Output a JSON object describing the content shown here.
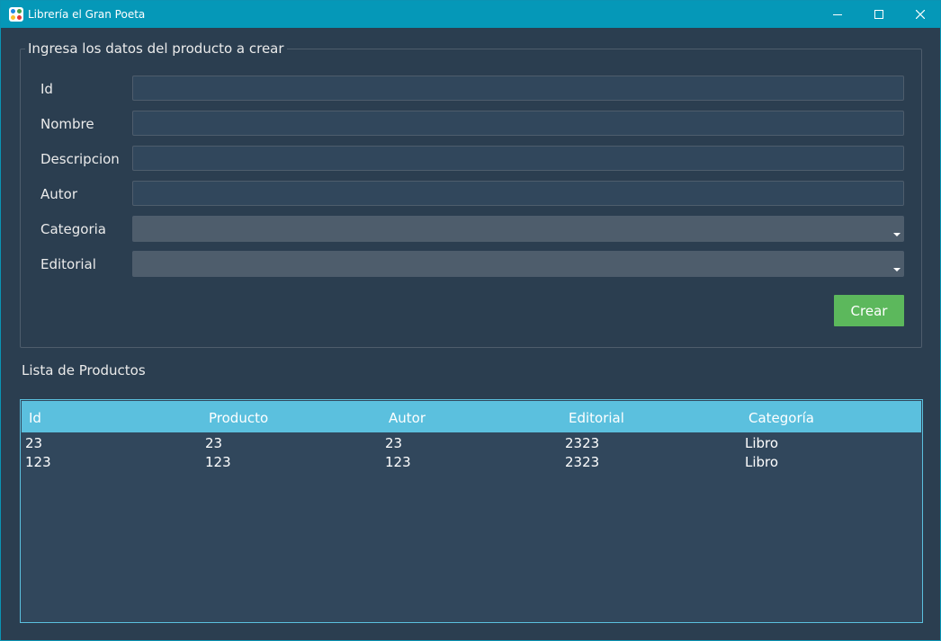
{
  "window": {
    "title": "Librería el Gran Poeta",
    "accent_color": "#0598b8",
    "icons": [
      "app-icon",
      "minimize-icon",
      "maximize-icon",
      "close-icon"
    ]
  },
  "form": {
    "group_title": "Ingresa los datos del producto a crear",
    "id_label": "Id",
    "id_value": "",
    "nombre_label": "Nombre",
    "nombre_value": "",
    "descripcion_label": "Descripcion",
    "descripcion_value": "",
    "autor_label": "Autor",
    "autor_value": "",
    "categoria_label": "Categoria",
    "categoria_value": "",
    "editorial_label": "Editorial",
    "editorial_value": "",
    "create_button": "Crear",
    "create_button_color": "#5cb85c"
  },
  "products": {
    "section_title": "Lista de Productos",
    "header_color": "#5bc0de",
    "columns": [
      "Id",
      "Producto",
      "Autor",
      "Editorial",
      "Categoría"
    ],
    "rows": [
      [
        "23",
        "23",
        "23",
        "2323",
        "Libro"
      ],
      [
        "123",
        "123",
        "123",
        "2323",
        "Libro"
      ]
    ]
  }
}
